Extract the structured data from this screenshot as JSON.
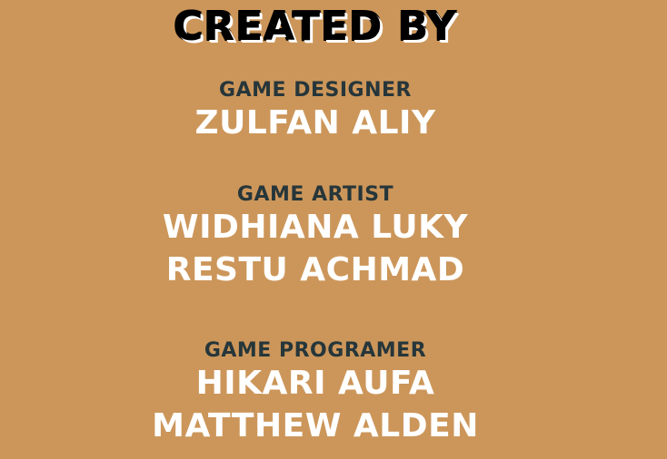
{
  "screen": {
    "title": "CREATED BY",
    "background_color": "#CC965A",
    "role_color": "#26363A",
    "name_color": "#FFFFFF"
  },
  "credits": [
    {
      "role": "GAME DESIGNER",
      "names": [
        "ZULFAN ALIY"
      ]
    },
    {
      "role": "GAME ARTIST",
      "names": [
        "WIDHIANA LUKY",
        "RESTU ACHMAD"
      ]
    },
    {
      "role": "GAME PROGRAMER",
      "names": [
        "HIKARI AUFA",
        "MATTHEW ALDEN"
      ]
    }
  ]
}
